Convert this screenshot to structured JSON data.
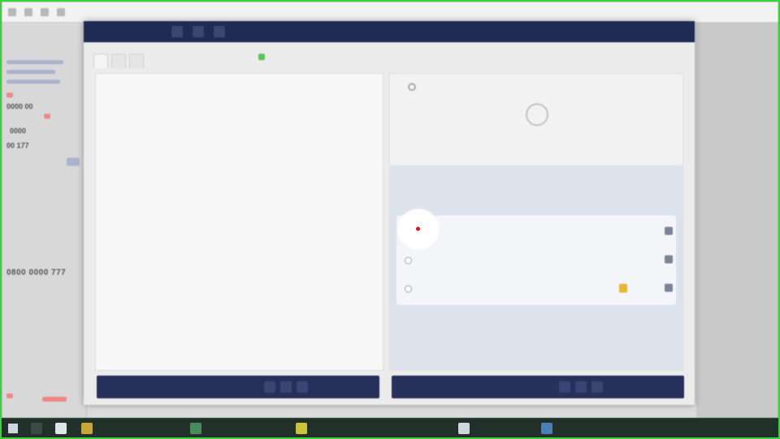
{
  "background_app": {
    "title": "",
    "right_text": "",
    "phone": "0800 0000 777",
    "tag_a": "0000 00",
    "tag_b": "0000",
    "tag_c": "00 177"
  },
  "dialog": {
    "title": "",
    "tabs": [
      "",
      "",
      ""
    ],
    "editor_lines": [
      "",
      "",
      "",
      "",
      "",
      "",
      "",
      "",
      "",
      ""
    ],
    "editor_footer_label": "",
    "right_footer_label": ""
  },
  "right_pane": {
    "search_placeholder": "",
    "empty_title": "",
    "empty_desc": ""
  },
  "ai_panel": {
    "title": "",
    "subtitle": "",
    "items": [
      {
        "code": "",
        "desc1": "",
        "desc2": "",
        "score": "",
        "badge": ""
      },
      {
        "code": "",
        "desc1": "",
        "desc2": "",
        "score": "",
        "badge": ""
      },
      {
        "code": "",
        "desc1": "",
        "desc2": "",
        "score": "",
        "badge": ""
      }
    ]
  },
  "taskbar": {
    "items": [
      "",
      "",
      "",
      "",
      "",
      ""
    ],
    "clock": ""
  },
  "colors": {
    "header": "#1f2b52",
    "footer": "#26305a",
    "accent_badge": "#e7b63a",
    "frame": "#3bd13b"
  }
}
